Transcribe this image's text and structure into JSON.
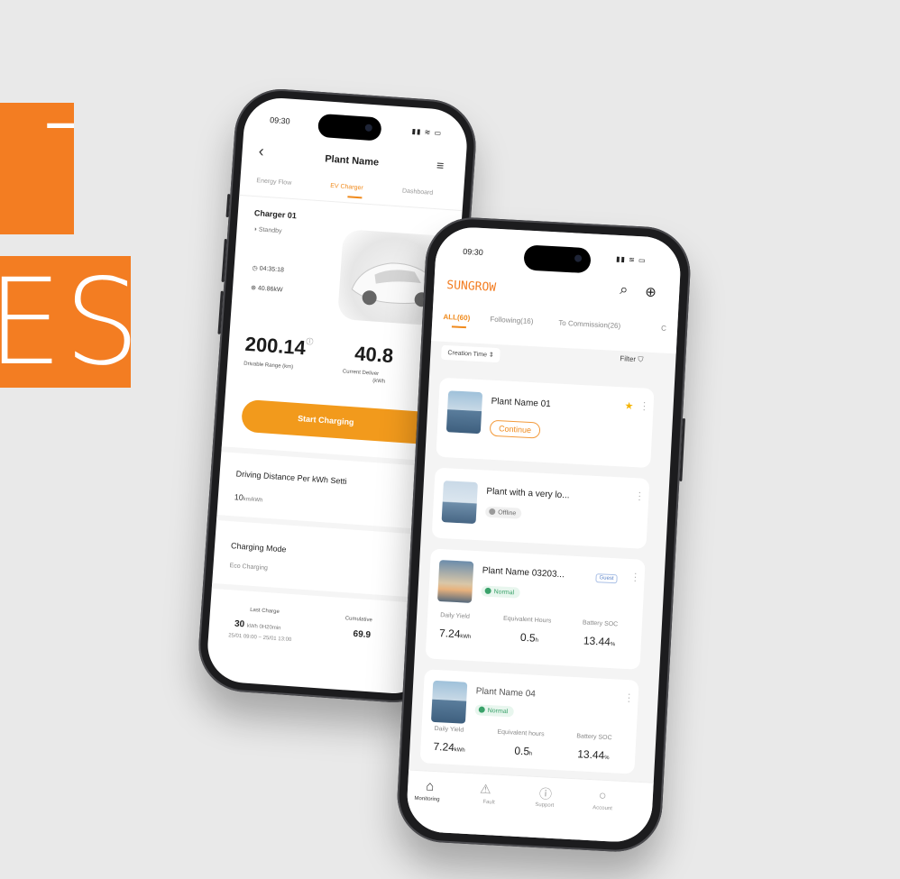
{
  "banner": {
    "line1": "T",
    "line2": "ES"
  },
  "phone1": {
    "time": "09:30",
    "title": "Plant Name",
    "tabs": [
      "Energy Flow",
      "EV Charger",
      "Dashboard"
    ],
    "charger_name": "Charger 01",
    "charger_status": "Standby",
    "timer": "04:35:18",
    "power": "40.86kW",
    "range_value": "200.14",
    "range_label": "Drivable Range  (km)",
    "delivered_value": "40.8",
    "delivered_label": "Current Deliver",
    "delivered_unit": "(kWh",
    "start_button": "Start Charging",
    "distance_title": "Driving Distance Per kWh Setti",
    "distance_value": "10",
    "distance_unit": "km/kWh",
    "mode_title": "Charging Mode",
    "mode_value": "Eco Charging",
    "last_charge_label": "Last Charge",
    "last_charge_value": "30",
    "last_charge_unit": "kWh  0H20min",
    "last_charge_range": "25/01 09:00 ~ 25/01 13:00",
    "cumulative_label": "Cumulative",
    "cumulative_value": "69.9"
  },
  "phone2": {
    "time": "09:30",
    "brand": "SUNGROW",
    "tabs": [
      "ALL(60)",
      "Following(16)",
      "To Commission(26)",
      "C"
    ],
    "sort_label": "Creation Time",
    "filter_label": "Filter",
    "plants": [
      {
        "name": "Plant Name 01",
        "action": "Continue"
      },
      {
        "name": "Plant with a very lo...",
        "status": "Offline"
      },
      {
        "name": "Plant Name 03203...",
        "badge": "Guest",
        "status": "Normal",
        "stats": [
          {
            "label": "Daily Yield",
            "value": "7.24",
            "unit": "kWh"
          },
          {
            "label": "Equivalent Hours",
            "value": "0.5",
            "unit": "h"
          },
          {
            "label": "Battery SOC",
            "value": "13.44",
            "unit": "%"
          }
        ]
      },
      {
        "name": "Plant Name 04",
        "status": "Normal",
        "stats": [
          {
            "label": "Daily Yield",
            "value": "7.24",
            "unit": "kWh"
          },
          {
            "label": "Equivalent hours",
            "value": "0.5",
            "unit": "h"
          },
          {
            "label": "Battery SOC",
            "value": "13.44",
            "unit": "%"
          }
        ]
      }
    ],
    "nav": [
      "Monitoring",
      "Fault",
      "Support",
      "Account"
    ]
  },
  "colors": {
    "accent": "#f37d22",
    "button": "#f29a1c",
    "ok": "#3aa26a",
    "background": "#e9e9e9"
  }
}
